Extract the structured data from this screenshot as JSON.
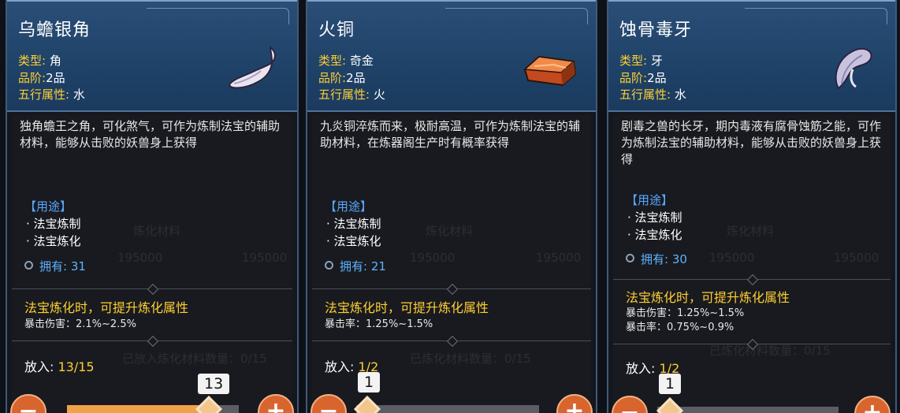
{
  "cards": [
    {
      "title": "乌蟾银角",
      "type_label": "类型:",
      "type_value": "角",
      "grade_label": "品阶:",
      "grade_value": "2品",
      "element_label": "五行属性:",
      "element_value": "水",
      "icon": "silver-horn-icon",
      "description": "独角蟾王之角，可化煞气，可作为炼制法宝的辅助材料，能够从击败的妖兽身上获得",
      "uses_header": "【用途】",
      "uses": [
        "· 法宝炼制",
        "· 法宝炼化"
      ],
      "own_label": "拥有:",
      "own_value": "31",
      "refine_effect": "法宝炼化时，可提升炼化属性",
      "stats": [
        "暴击伤害：2.1%~2.5%"
      ],
      "put_label": "放入:",
      "put_value": "13/15",
      "slider_value": "13",
      "slider_fraction": 0.87
    },
    {
      "title": "火铜",
      "type_label": "类型:",
      "type_value": "奇金",
      "grade_label": "品阶:",
      "grade_value": "2品",
      "element_label": "五行属性:",
      "element_value": "火",
      "icon": "fire-copper-ingot-icon",
      "description": "九炎铜淬炼而来，极耐高温，可作为炼制法宝的辅助材料，在炼器阁生产时有概率获得",
      "uses_header": "【用途】",
      "uses": [
        "· 法宝炼制",
        "· 法宝炼化"
      ],
      "own_label": "拥有:",
      "own_value": "21",
      "refine_effect": "法宝炼化时，可提升炼化属性",
      "stats": [
        "暴击率：1.25%~1.5%"
      ],
      "put_label": "放入:",
      "put_value": "1/2",
      "slider_value": "1",
      "slider_fraction": 0.0
    },
    {
      "title": "蚀骨毒牙",
      "type_label": "类型:",
      "type_value": "牙",
      "grade_label": "品阶:",
      "grade_value": "2品",
      "element_label": "五行属性:",
      "element_value": "水",
      "icon": "poison-fang-icon",
      "description": "剧毒之兽的长牙，期内毒液有腐骨蚀筋之能，可作为炼制法宝的辅助材料，能够从击败的妖兽身上获得",
      "uses_header": "【用途】",
      "uses": [
        "· 法宝炼制",
        "· 法宝炼化"
      ],
      "own_label": "拥有:",
      "own_value": "30",
      "refine_effect": "法宝炼化时，可提升炼化属性",
      "stats": [
        "暴击伤害：1.25%~1.5%",
        "暴击率：0.75%~0.9%"
      ],
      "put_label": "放入:",
      "put_value": "1/2",
      "slider_value": "1",
      "slider_fraction": 0.0
    }
  ],
  "background_text": {
    "refine_material": "炼化材料",
    "amount": "195000",
    "material_count_1": "已放入炼化材料数量：0/15",
    "material_count_2": "已炼化材料数量：0/15"
  },
  "colors": {
    "header_blue": "#1f4268",
    "gold_text": "#ffcf33",
    "blue_text": "#5aa8ff",
    "button_orange": "#d8652e",
    "slider_fill": "#f0a24a"
  }
}
